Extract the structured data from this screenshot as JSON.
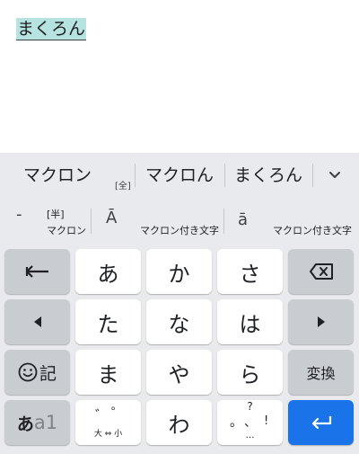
{
  "editor": {
    "composing_text": "まくろん"
  },
  "candidates": {
    "items": [
      {
        "label": "マクロン",
        "tag": "[全]"
      },
      {
        "label": "マクロん"
      },
      {
        "label": "まくろん"
      }
    ],
    "expand_icon": "chevron-down-icon"
  },
  "suggestions": [
    {
      "main": "-",
      "tag": "[半]",
      "sub": "マクロン"
    },
    {
      "main": "Ā",
      "sub": "マクロン付き文字"
    },
    {
      "main": "ā",
      "sub": "マクロン付き文字"
    }
  ],
  "keys": {
    "row1": [
      "あ",
      "か",
      "さ"
    ],
    "row2": [
      "た",
      "な",
      "は"
    ],
    "row3": [
      "ま",
      "や",
      "ら"
    ],
    "convert": "変換",
    "emoji_label": "記",
    "mode_label_kana": "あ",
    "mode_label_alpha": "a1",
    "wa": "わ",
    "dakuten": {
      "top_left": "゛",
      "top_right": "゜",
      "bottom": "大 ⇔ 小"
    },
    "punct": {
      "top": "?",
      "left": "。",
      "center": "、",
      "right": "!",
      "bottom": "…"
    }
  },
  "colors": {
    "keyboard_bg": "#e8eaed",
    "function_key": "#c9ccd1",
    "accent": "#1a73e8",
    "composing_highlight": "#b6e3df"
  }
}
